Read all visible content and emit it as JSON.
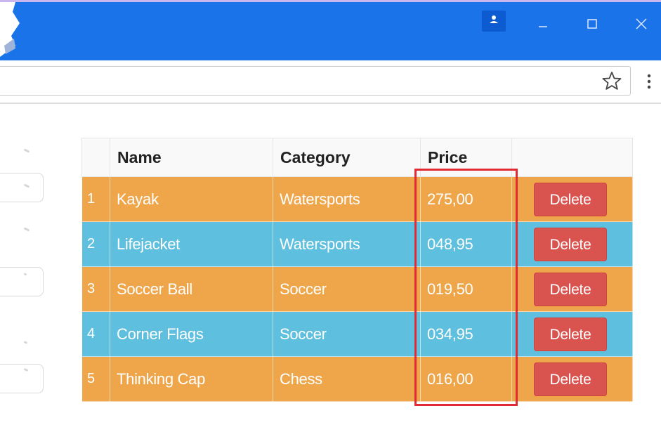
{
  "colors": {
    "titlebar": "#1a73e8",
    "row_odd": "#efa64a",
    "row_even": "#5ebfde",
    "delete_button": "#d9534f",
    "highlight_box": "#e02b34"
  },
  "window_controls": {
    "profile_icon": "person-icon",
    "minimize_icon": "minimize-icon",
    "maximize_icon": "maximize-icon",
    "close_icon": "close-icon"
  },
  "toolbar": {
    "bookmark_icon": "star-icon",
    "menu_icon": "more-vert-icon"
  },
  "table": {
    "headers": [
      "",
      "Name",
      "Category",
      "Price",
      ""
    ],
    "rows": [
      {
        "index": "1",
        "name": "Kayak",
        "category": "Watersports",
        "price": "275,00",
        "action": "Delete"
      },
      {
        "index": "2",
        "name": "Lifejacket",
        "category": "Watersports",
        "price": "048,95",
        "action": "Delete"
      },
      {
        "index": "3",
        "name": "Soccer Ball",
        "category": "Soccer",
        "price": "019,50",
        "action": "Delete"
      },
      {
        "index": "4",
        "name": "Corner Flags",
        "category": "Soccer",
        "price": "034,95",
        "action": "Delete"
      },
      {
        "index": "5",
        "name": "Thinking Cap",
        "category": "Chess",
        "price": "016,00",
        "action": "Delete"
      }
    ]
  }
}
